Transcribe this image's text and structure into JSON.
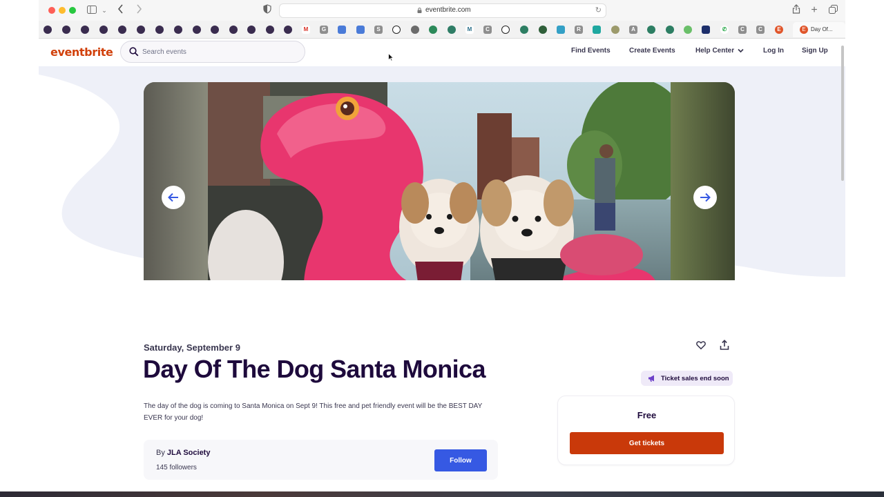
{
  "browser": {
    "url": "eventbrite.com",
    "active_tab_label": "Day Of...",
    "bookmark_letters": [
      "M",
      "G",
      "S",
      "C",
      "C",
      "R",
      "A",
      "C",
      "C",
      "E"
    ]
  },
  "site": {
    "logo": "eventbrite",
    "search_placeholder": "Search events",
    "nav": {
      "find_events": "Find Events",
      "create_events": "Create Events",
      "help_center": "Help Center",
      "log_in": "Log In",
      "sign_up": "Sign Up"
    },
    "brand_color": "#d1410c"
  },
  "carousel": {
    "slide_progress": 0.25
  },
  "event": {
    "date": "Saturday, September 9",
    "title": "Day Of The Dog Santa Monica",
    "description": "The day of the dog is coming to Santa Monica on Sept 9! This free and pet friendly event will be the BEST DAY EVER for your dog!",
    "badge": "Ticket sales end soon",
    "price": "Free",
    "cta": "Get tickets",
    "organizer_prefix": "By",
    "organizer_name": "JLA Society",
    "followers": "145 followers",
    "follow": "Follow"
  }
}
